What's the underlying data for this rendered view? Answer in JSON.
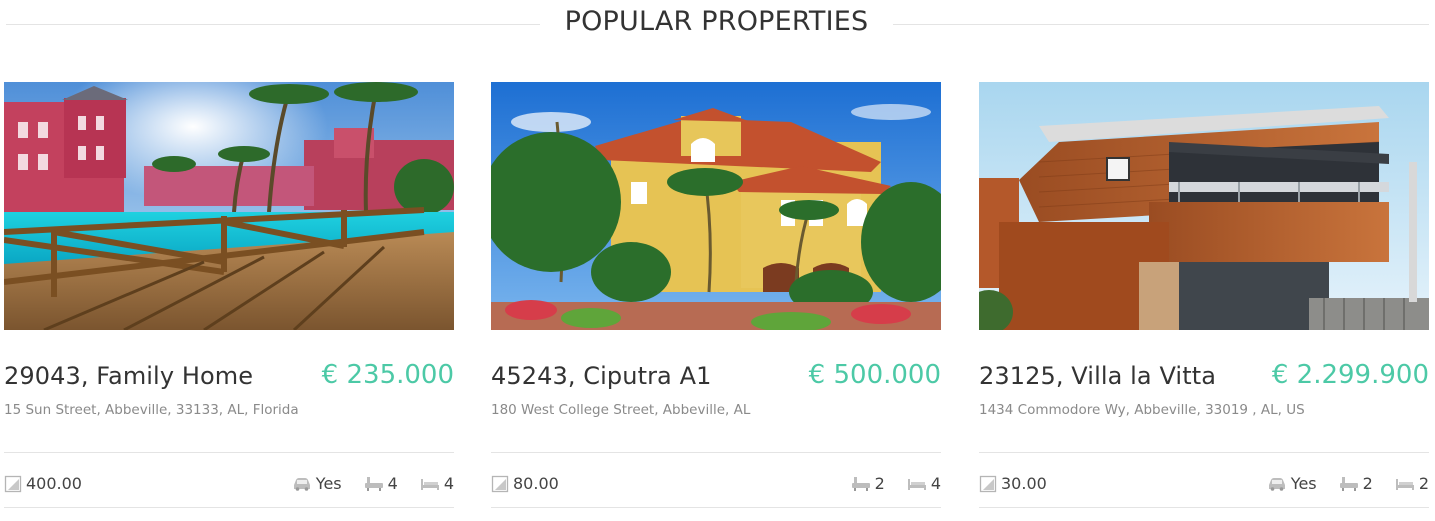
{
  "section": {
    "title": "POPULAR PROPERTIES"
  },
  "colors": {
    "accent": "#4cc9a6",
    "text": "#333333",
    "muted": "#8a8a8a",
    "rule": "#e4e4e4"
  },
  "properties": [
    {
      "title": "29043, Family Home",
      "price": "€ 235.000",
      "address": "15 Sun Street, Abbeville, 33133, AL, Florida",
      "area": "400.00",
      "garage": "Yes",
      "baths": "4",
      "beds": "4",
      "photo": "resort-pool-with-palms"
    },
    {
      "title": "45243, Ciputra A1",
      "price": "€ 500.000",
      "address": "180 West College Street, Abbeville, AL",
      "area": "80.00",
      "baths": "2",
      "beds": "4",
      "photo": "yellow-villa-with-palms"
    },
    {
      "title": "23125, Villa la Vitta",
      "price": "€ 2.299.900",
      "address": "1434 Commodore Wy, Abbeville, 33019 , AL, US",
      "area": "30.00",
      "garage": "Yes",
      "baths": "2",
      "beds": "2",
      "photo": "modern-wooden-house"
    }
  ],
  "icons": {
    "area": "area-icon",
    "garage": "car-icon",
    "baths": "bathtub-icon",
    "beds": "bed-icon"
  }
}
